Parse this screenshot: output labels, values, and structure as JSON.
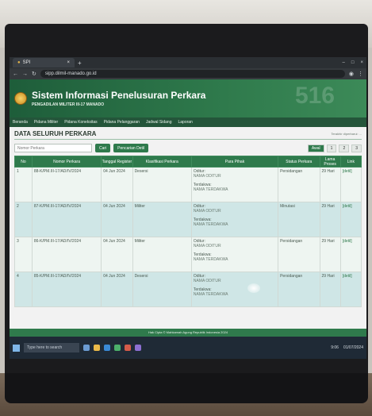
{
  "browser": {
    "tab_title": "SPI",
    "new_tab": "+",
    "url": "sipp.dilmil-manado.go.id",
    "window_controls": [
      "–",
      "□",
      "×"
    ]
  },
  "site": {
    "title": "Sistem Informasi Penelusuran Perkara",
    "subtitle": "PENGADILAN MILITER III-17 MANADO",
    "bg_text": "516"
  },
  "nav": [
    "Beranda",
    "Pidana Militer",
    "Pidana Koneksitas",
    "Pidana Pelanggaran",
    "Jadwal Sidang",
    "Laporan"
  ],
  "content": {
    "heading": "DATA SELURUH PERKARA",
    "update_note": "Terakhir diperbarui: ..."
  },
  "search": {
    "placeholder": "Nomor Perkara",
    "search_button": "Cari",
    "advanced_button": "Pencarian Detil"
  },
  "pager": [
    "Awal",
    "1",
    "2",
    "3"
  ],
  "table": {
    "headers": [
      "No",
      "Nomor Perkara",
      "Tanggal Register",
      "Klasifikasi Perkara",
      "Para Pihak",
      "Status Perkara",
      "Lama Proses",
      "Link"
    ],
    "rows": [
      {
        "no": "1",
        "nomor": "88-K/PM.III-17/AD/IV/2024",
        "tanggal": "04 Jun 2024",
        "klasifikasi": "Desersi",
        "pihak1_label": "Oditur:",
        "pihak1_name": "NAMA ODITUR",
        "pihak2_label": "Terdakwa:",
        "pihak2_name": "NAMA TERDAKWA",
        "status": "Persidangan",
        "lama": "29 Hari",
        "link": "[detil]"
      },
      {
        "no": "2",
        "nomor": "87-K/PM.III-17/AD/IV/2024",
        "tanggal": "04 Jun 2024",
        "klasifikasi": "Militer",
        "pihak1_label": "Oditur:",
        "pihak1_name": "NAMA ODITUR",
        "pihak2_label": "Terdakwa:",
        "pihak2_name": "NAMA TERDAKWA",
        "status": "Minutasi",
        "lama": "29 Hari",
        "link": "[detil]"
      },
      {
        "no": "3",
        "nomor": "86-K/PM.III-17/AD/IV/2024",
        "tanggal": "04 Jun 2024",
        "klasifikasi": "Militer",
        "pihak1_label": "Oditur:",
        "pihak1_name": "NAMA ODITUR",
        "pihak2_label": "Terdakwa:",
        "pihak2_name": "NAMA TERDAKWA",
        "status": "Persidangan",
        "lama": "29 Hari",
        "link": "[detil]"
      },
      {
        "no": "4",
        "nomor": "85-K/PM.III-17/AD/IV/2024",
        "tanggal": "04 Jun 2024",
        "klasifikasi": "Desersi",
        "pihak1_label": "Oditur:",
        "pihak1_name": "NAMA ODITUR",
        "pihak2_label": "Terdakwa:",
        "pihak2_name": "NAMA TERDAKWA",
        "status": "Persidangan",
        "lama": "29 Hari",
        "link": "[detil]"
      }
    ]
  },
  "footer": "Hak Cipta © Mahkamah Agung Republik Indonesia 2024",
  "taskbar": {
    "search_placeholder": "Type here to search",
    "time": "9:06",
    "date": "01/07/2024"
  }
}
